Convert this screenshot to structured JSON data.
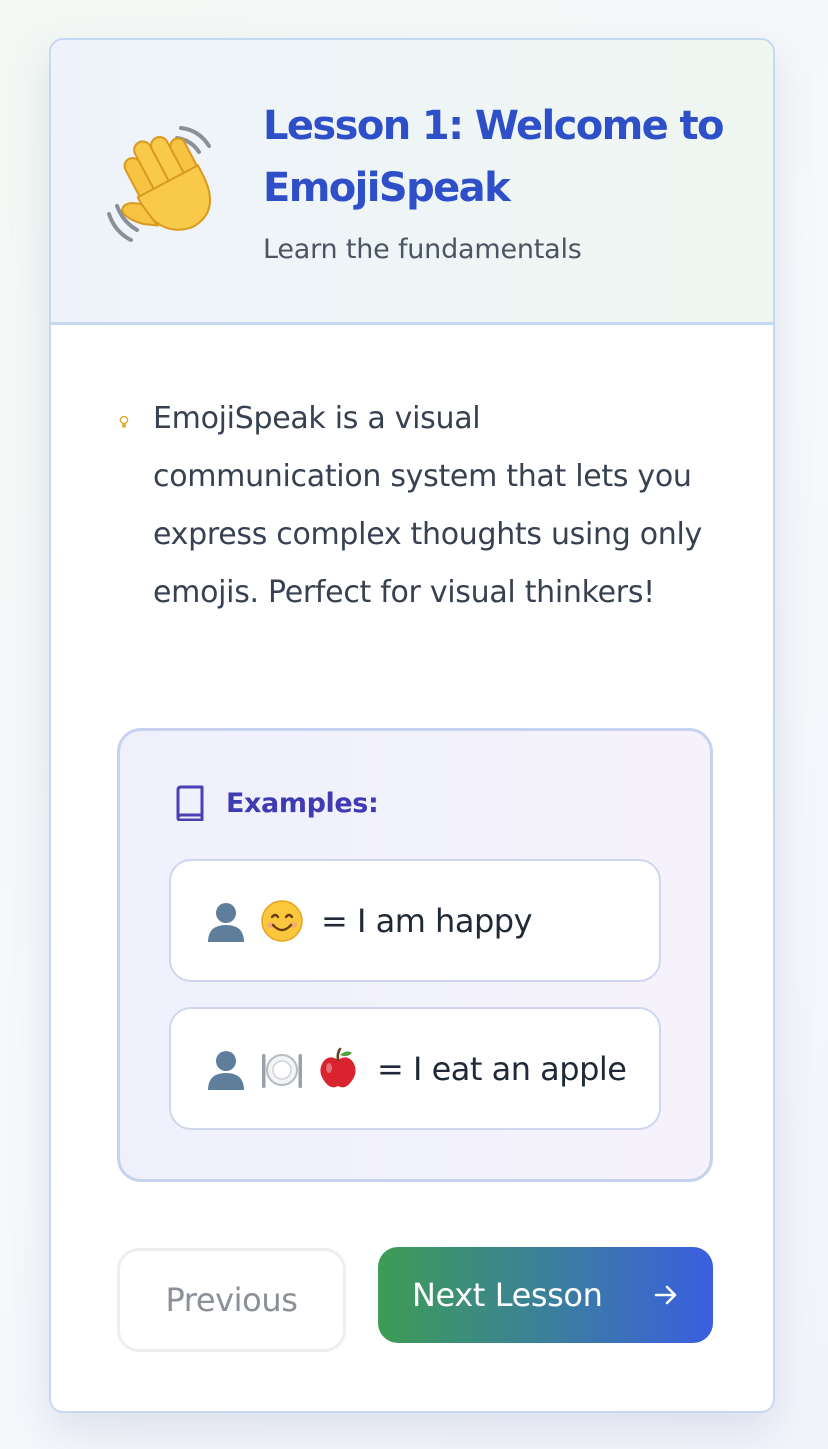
{
  "header": {
    "title": "Lesson 1: Welcome to EmojiSpeak",
    "subtitle": "Learn the fundamentals",
    "icon": "waving-hand-icon"
  },
  "intro": {
    "icon": "lightbulb-icon",
    "text": "EmojiSpeak is a visual communication system that lets you express complex thoughts using only emojis. Perfect for visual thinkers!"
  },
  "examples": {
    "icon": "book-icon",
    "heading": "Examples:",
    "items": [
      {
        "emojis": [
          "person-silhouette-icon",
          "smiling-face-icon"
        ],
        "meaning": "= I am happy"
      },
      {
        "emojis": [
          "person-silhouette-icon",
          "plate-cutlery-icon",
          "apple-icon"
        ],
        "meaning": "= I eat an apple"
      }
    ]
  },
  "navigation": {
    "previous_label": "Previous",
    "next_label": "Next Lesson",
    "next_icon": "arrow-right-icon"
  },
  "colors": {
    "title": "#2e4fc7",
    "examples_heading": "#3f3bb0",
    "next_gradient_start": "#3d9c55",
    "next_gradient_end": "#3b5ee0",
    "card_border": "#c6d9f2"
  }
}
